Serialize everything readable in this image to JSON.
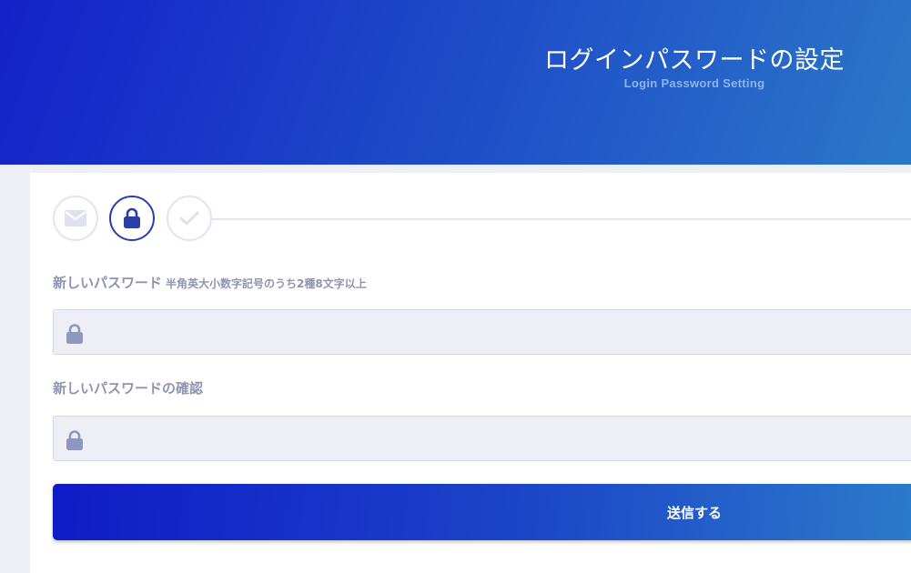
{
  "header": {
    "title": "ログインパスワードの設定",
    "subtitle": "Login Password Setting"
  },
  "steps": [
    {
      "icon": "envelope-icon",
      "state": "done"
    },
    {
      "icon": "lock-icon",
      "state": "active"
    },
    {
      "icon": "check-icon",
      "state": "pending"
    }
  ],
  "form": {
    "new_password": {
      "label": "新しいパスワード",
      "hint": "半角英大小数字記号のうち2種8文字以上",
      "value": "",
      "icon": "lock-icon"
    },
    "confirm_password": {
      "label": "新しいパスワードの確認",
      "value": "",
      "icon": "lock-icon"
    },
    "submit_label": "送信する"
  },
  "colors": {
    "brand_start": "#1322c9",
    "brand_end": "#2b78c9",
    "active_step": "#2a3ea8",
    "muted_label": "#8f94b0",
    "field_bg": "#eeeff5"
  }
}
